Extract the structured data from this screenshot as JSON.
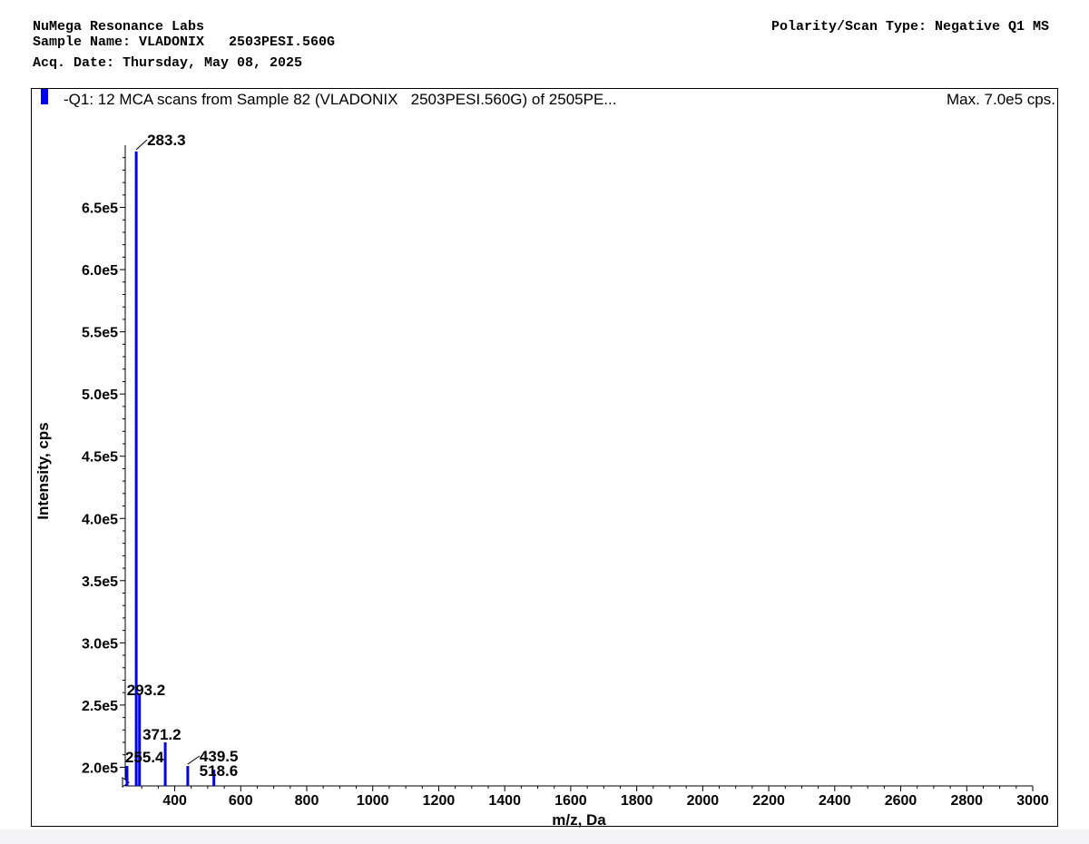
{
  "header": {
    "lab": "NuMega Resonance Labs",
    "sample": "Sample Name: VLADONIX   2503PESI.560G",
    "date": "Acq. Date: Thursday, May 08, 2025",
    "polarity": "Polarity/Scan Type: Negative Q1 MS"
  },
  "legend": {
    "text": "-Q1: 12 MCA scans from Sample 82 (VLADONIX   2503PESI.560G) of 2505PE...",
    "color": "#0000ee"
  },
  "max_label": "Max. 7.0e5 cps.",
  "chart_data": {
    "type": "bar",
    "xlabel": "m/z, Da",
    "ylabel": "Intensity, cps",
    "xlim": [
      250,
      3000
    ],
    "ylim": [
      185000,
      700000
    ],
    "x_ticks": [
      400,
      600,
      800,
      1000,
      1200,
      1400,
      1600,
      1800,
      2000,
      2200,
      2400,
      2600,
      2800,
      3000
    ],
    "x_tick_labels": [
      "400",
      "600",
      "800",
      "1000",
      "1200",
      "1400",
      "1600",
      "1800",
      "2000",
      "2200",
      "2400",
      "2600",
      "2800",
      "3000"
    ],
    "y_ticks": [
      200000,
      250000,
      300000,
      350000,
      400000,
      450000,
      500000,
      550000,
      600000,
      650000
    ],
    "y_tick_labels": [
      "2.0e5",
      "2.5e5",
      "3.0e5",
      "3.5e5",
      "4.0e5",
      "4.5e5",
      "5.0e5",
      "5.5e5",
      "6.0e5",
      "6.5e5"
    ],
    "series": [
      {
        "color": "#0000ee",
        "peaks": [
          {
            "mz": 255.4,
            "intensity": 201000,
            "label": "255.4"
          },
          {
            "mz": 283.3,
            "intensity": 695000,
            "label": "283.3"
          },
          {
            "mz": 293.2,
            "intensity": 258000,
            "label": "293.2"
          },
          {
            "mz": 371.2,
            "intensity": 220000,
            "label": "371.2"
          },
          {
            "mz": 439.5,
            "intensity": 201000,
            "label": "439.5"
          },
          {
            "mz": 518.6,
            "intensity": 198000,
            "label": "518.6"
          }
        ]
      }
    ]
  }
}
